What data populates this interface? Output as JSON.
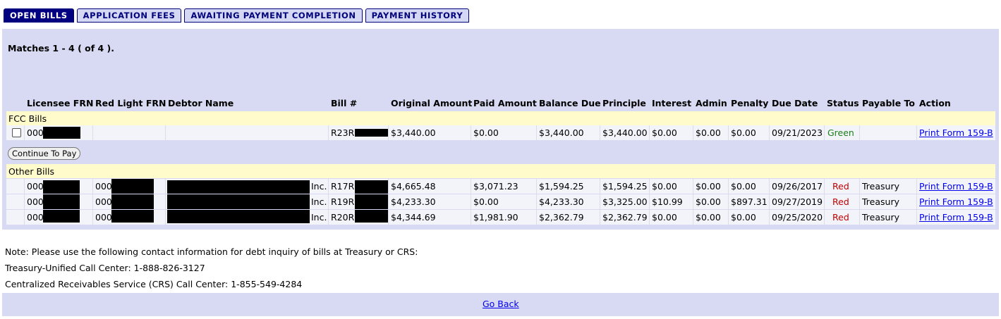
{
  "tabs": [
    {
      "label": "OPEN BILLS",
      "active": true
    },
    {
      "label": "APPLICATION FEES",
      "active": false
    },
    {
      "label": "AWAITING PAYMENT COMPLETION",
      "active": false
    },
    {
      "label": "PAYMENT HISTORY",
      "active": false
    }
  ],
  "matches": "Matches 1 - 4 ( of 4 ).",
  "columns": [
    "Licensee FRN",
    "Red Light FRN",
    "Debtor Name",
    "Bill #",
    "Original Amount",
    "Paid Amount",
    "Balance Due",
    "Principle",
    "Interest",
    "Admin",
    "Penalty",
    "Due Date",
    "Status",
    "Payable To",
    "Action"
  ],
  "fcc_section_label": "FCC Bills",
  "fcc_bills": [
    {
      "licensee_frn": "000",
      "red_light_frn": "",
      "debtor_name": "",
      "bill": "R23R",
      "original": "$3,440.00",
      "paid": "$0.00",
      "balance": "$3,440.00",
      "principle": "$3,440.00",
      "interest": "$0.00",
      "admin": "$0.00",
      "penalty": "$0.00",
      "due_date": "09/21/2023",
      "status": "Green",
      "payable_to": "",
      "action": "Print Form 159-B"
    }
  ],
  "continue_button": "Continue To Pay",
  "other_section_label": "Other Bills",
  "other_bills": [
    {
      "licensee_frn": "000",
      "red_light_frn": "000",
      "debtor_name": "Inc.",
      "bill": "R17R",
      "original": "$4,665.48",
      "paid": "$3,071.23",
      "balance": "$1,594.25",
      "principle": "$1,594.25",
      "interest": "$0.00",
      "admin": "$0.00",
      "penalty": "$0.00",
      "due_date": "09/26/2017",
      "status": "Red",
      "payable_to": "Treasury",
      "action": "Print Form 159-B"
    },
    {
      "licensee_frn": "000",
      "red_light_frn": "000",
      "debtor_name": "Inc.",
      "bill": "R19R",
      "original": "$4,233.30",
      "paid": "$0.00",
      "balance": "$4,233.30",
      "principle": "$3,325.00",
      "interest": "$10.99",
      "admin": "$0.00",
      "penalty": "$897.31",
      "due_date": "09/27/2019",
      "status": "Red",
      "payable_to": "Treasury",
      "action": "Print Form 159-B"
    },
    {
      "licensee_frn": "000",
      "red_light_frn": "000",
      "debtor_name": "Inc.",
      "bill": "R20R",
      "original": "$4,344.69",
      "paid": "$1,981.90",
      "balance": "$2,362.79",
      "principle": "$2,362.79",
      "interest": "$0.00",
      "admin": "$0.00",
      "penalty": "$0.00",
      "due_date": "09/25/2020",
      "status": "Red",
      "payable_to": "Treasury",
      "action": "Print Form 159-B"
    }
  ],
  "notes": {
    "line1": "Note: Please use the following contact information for debt inquiry of bills at Treasury or CRS:",
    "line2": "Treasury-Unified Call Center: 1-888-826-3127",
    "line3": "Centralized Receivables Service (CRS) Call Center: 1-855-549-4284"
  },
  "go_back": "Go Back",
  "colors": {
    "nav": "#000080",
    "panel": "#d7daf2",
    "band": "#fffbcb",
    "green": "#1a7f1a",
    "red": "#c40000",
    "link": "#0000ee"
  }
}
